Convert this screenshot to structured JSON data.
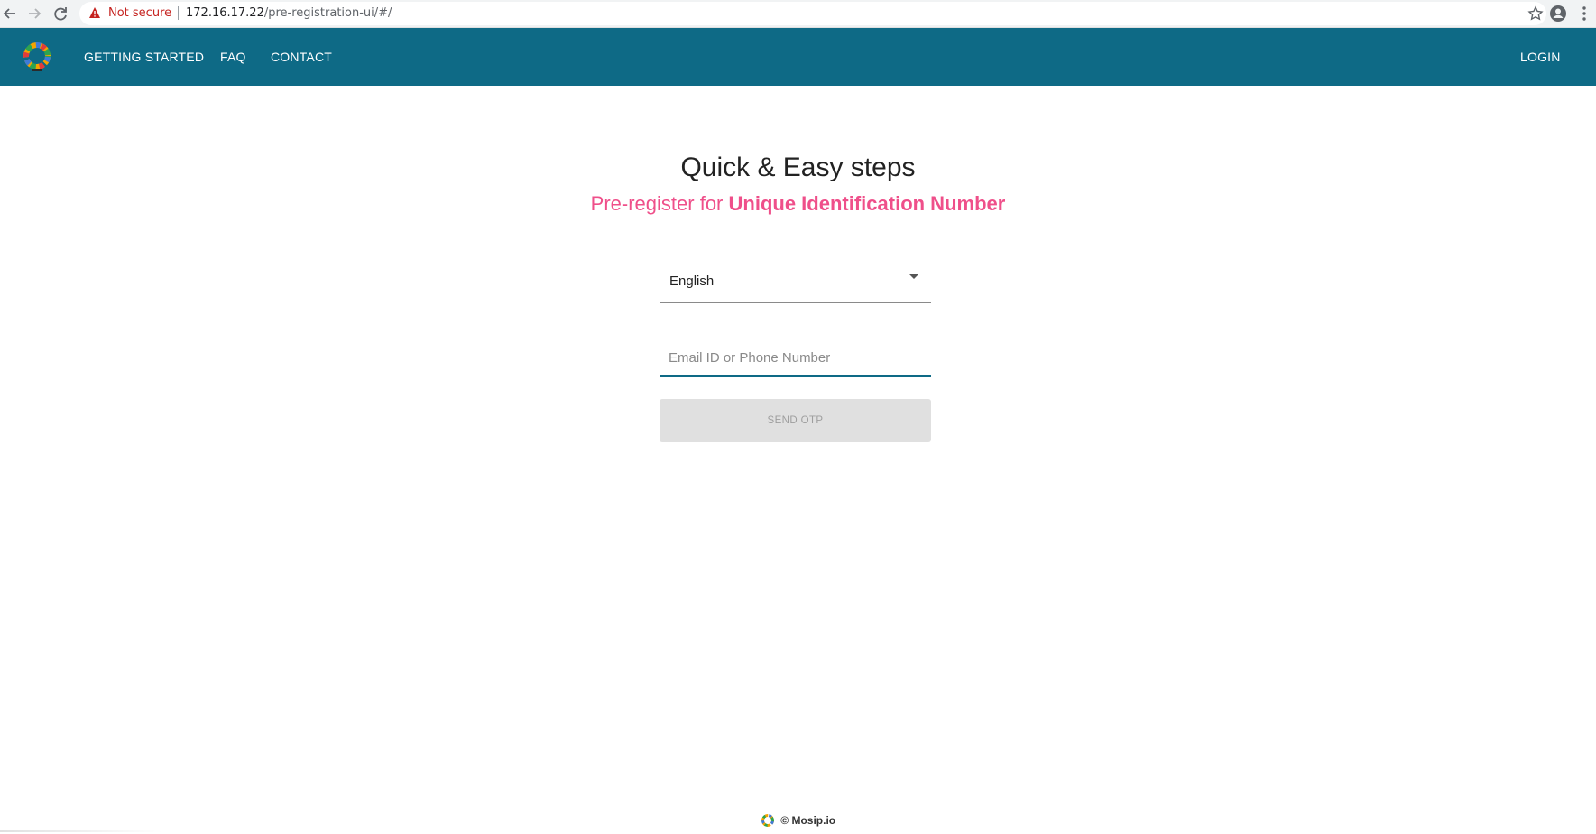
{
  "browser": {
    "security_label": "Not secure",
    "url_host": "172.16.17.22",
    "url_path": "/pre-registration-ui/#/"
  },
  "header": {
    "nav": {
      "getting_started": "GETTING STARTED",
      "faq": "FAQ",
      "contact": "CONTACT",
      "login": "LOGIN"
    },
    "bg_color": "#0e6a86"
  },
  "main": {
    "headline": "Quick & Easy steps",
    "subline_prefix": "Pre-register for",
    "subline_emphasis": "Unique Identification Number",
    "accent_color": "#ef4f8a",
    "language_select": {
      "selected": "English"
    },
    "email_input": {
      "placeholder": "Email ID or Phone Number",
      "value": ""
    },
    "send_otp_label": "SEND OTP"
  },
  "footer": {
    "text": "© Mosip.io"
  }
}
